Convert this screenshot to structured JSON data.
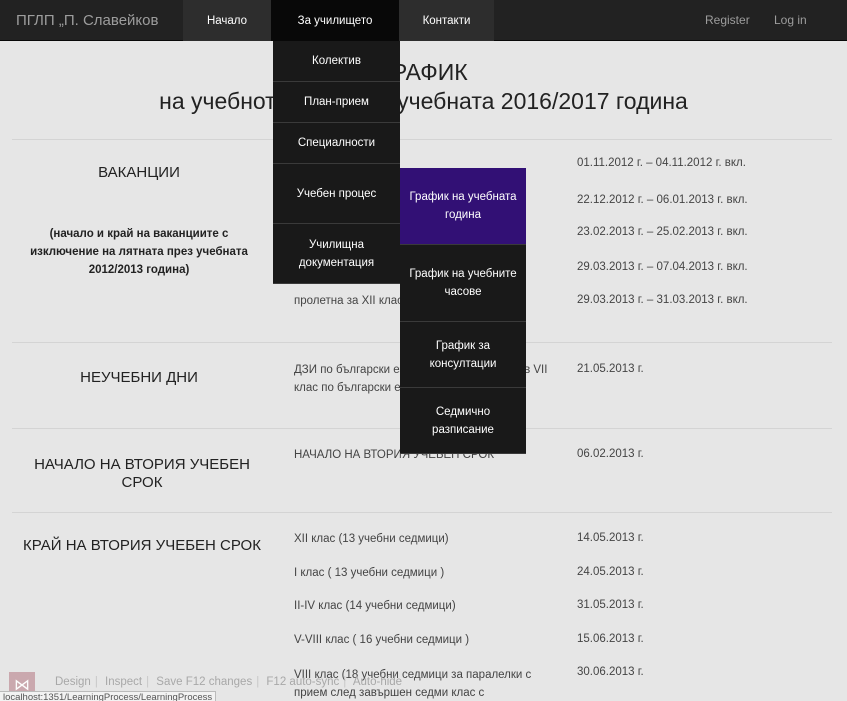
{
  "nav": {
    "brand": "ПГЛП „П. Славейков",
    "items": [
      "Начало",
      "За училището",
      "Контакти"
    ],
    "register": "Register",
    "login": "Log in"
  },
  "title": {
    "line1": "ГРАФИК",
    "line2": "на учебното време за учебната 2016/2017 година"
  },
  "sections": {
    "vacations": {
      "heading": "ВАКАНЦИИ",
      "note": "(начало и край на ваканциите с изключение на лятната през учебната 2012/2013 година)",
      "rows": [
        {
          "event": "",
          "date": "01.11.2012 г. – 04.11.2012 г. вкл."
        },
        {
          "event": "",
          "date": "22.12.2012 г. – 06.01.2013 г. вкл."
        },
        {
          "event": "",
          "date": "23.02.2013 г. – 25.02.2013 г. вкл."
        },
        {
          "event": "",
          "date": "29.03.2013 г. – 07.04.2013 г. вкл."
        },
        {
          "event": "пролетна за XII клас",
          "date": "29.03.2013 г. – 31.03.2013 г. вкл."
        }
      ]
    },
    "nonschool": {
      "heading": "НЕУЧЕБНИ ДНИ",
      "event": "ДЗИ по български език и литература; НВО в VII клас по български език и литература",
      "date": "21.05.2013 г."
    },
    "term_start": {
      "heading": "НАЧАЛО НА ВТОРИЯ УЧЕБЕН СРОК",
      "event": "НАЧАЛО НА ВТОРИЯ УЧЕБЕН СРОК",
      "date": "06.02.2013 г."
    },
    "term_end": {
      "heading": "КРАЙ НА ВТОРИЯ УЧЕБЕН СРОК",
      "rows": [
        {
          "event": "XII клас (13 учебни седмици)",
          "date": "14.05.2013 г."
        },
        {
          "event": "I клас ( 13 учебни седмици )",
          "date": "24.05.2013 г."
        },
        {
          "event": "II-IV клас (14 учебни седмици)",
          "date": "31.05.2013 г."
        },
        {
          "event": "V-VIII клас ( 16 учебни седмици )",
          "date": "15.06.2013 г."
        },
        {
          "event": "VIII клас (18 учебни седмици за паралелки с прием след завършен седми клас с",
          "date": "30.06.2013 г."
        }
      ]
    }
  },
  "dropdown": [
    "Колектив",
    "План-прием",
    "Специалности",
    "Учебен процес",
    "Училищна документация"
  ],
  "submenu": [
    "График на учебната година",
    "График на учебните часове",
    "График за консултации",
    "Седмично разписание"
  ],
  "devtools": {
    "items": [
      "Design",
      "Inspect",
      "Save F12 changes",
      "F12 auto-sync",
      "Auto-hide"
    ],
    "status_url": "localhost:1351/LearningProcess/LearningProcess"
  }
}
